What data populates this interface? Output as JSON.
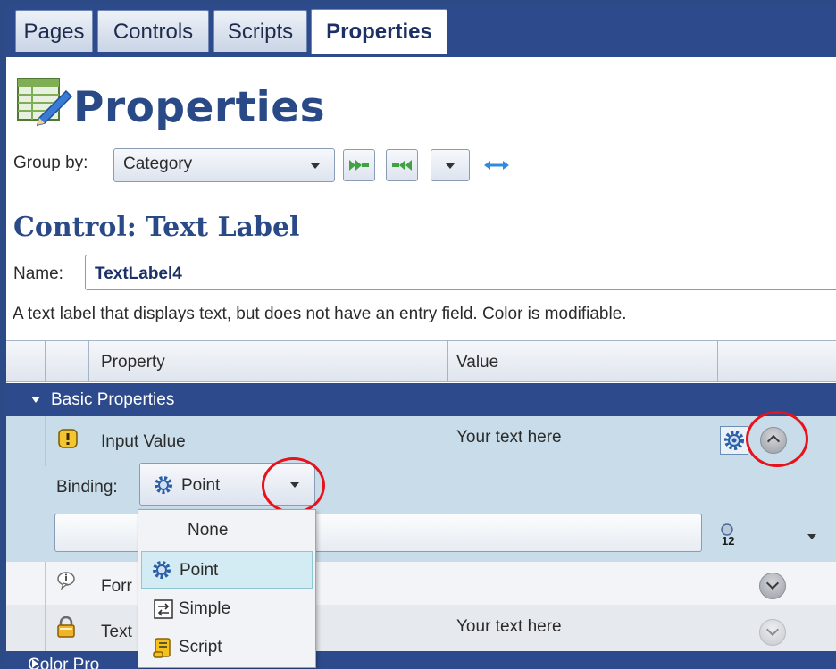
{
  "tabs": [
    {
      "label": "Pages",
      "active": false
    },
    {
      "label": "Controls",
      "active": false
    },
    {
      "label": "Scripts",
      "active": false
    },
    {
      "label": "Properties",
      "active": true
    }
  ],
  "header": {
    "title": "Properties",
    "icon": "properties-pencil-icon"
  },
  "group_by": {
    "label": "Group by:",
    "value": "Category",
    "buttons": [
      "expand-all-icon",
      "collapse-all-icon",
      "dropdown-icon",
      "resize-arrow-icon"
    ]
  },
  "control": {
    "title": "Control: Text Label",
    "name_label": "Name:",
    "name_value": "TextLabel4",
    "description": "A text label that displays text, but does not have an entry field. Color is modifiable."
  },
  "grid": {
    "headers": {
      "property": "Property",
      "value": "Value"
    },
    "group": "Basic Properties",
    "rows": [
      {
        "icon": "warning-icon",
        "name": "Input Value",
        "value": "Your text here"
      },
      {
        "icon": "info-icon",
        "name": "Forr",
        "value": ""
      },
      {
        "icon": "lock-icon",
        "name": "Text",
        "value": "Your text here"
      }
    ],
    "bottom_group": "Color Pro"
  },
  "binding": {
    "label": "Binding:",
    "value": "Point",
    "options": [
      {
        "label": "None",
        "icon": ""
      },
      {
        "label": "Point",
        "icon": "gear-icon"
      },
      {
        "label": "Simple",
        "icon": "swap-icon"
      },
      {
        "label": "Script",
        "icon": "scroll-icon"
      }
    ]
  },
  "colors": {
    "navy": "#2d4b8c",
    "highlight": "#c8dcea",
    "annotation": "#e8121b"
  }
}
